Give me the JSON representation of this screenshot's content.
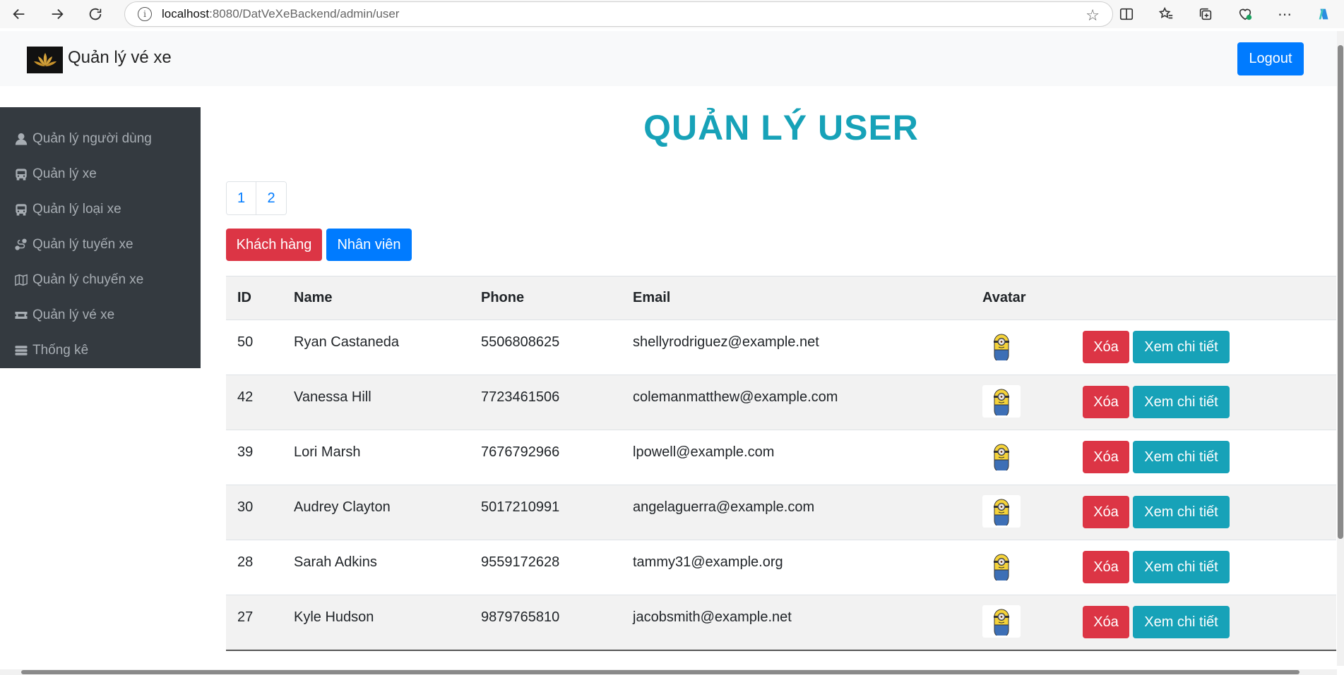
{
  "browser": {
    "url_host": "localhost",
    "url_path": ":8080/DatVeXeBackend/admin/user"
  },
  "navbar": {
    "brand": "Quản lý vé xe",
    "logout_label": "Logout"
  },
  "sidebar": {
    "items": [
      {
        "label": "Quản lý người dùng",
        "icon": "user-icon"
      },
      {
        "label": "Quản lý xe",
        "icon": "bus-icon"
      },
      {
        "label": "Quản lý loại xe",
        "icon": "bus-icon"
      },
      {
        "label": "Quản lý tuyến xe",
        "icon": "route-icon"
      },
      {
        "label": "Quản lý chuyến xe",
        "icon": "map-icon"
      },
      {
        "label": "Quản lý vé xe",
        "icon": "ticket-icon"
      },
      {
        "label": "Thống kê",
        "icon": "bars-icon"
      }
    ]
  },
  "main": {
    "title": "QUẢN LÝ USER",
    "pages": [
      "1",
      "2"
    ],
    "filters": {
      "customer_label": "Khách hàng",
      "staff_label": "Nhân viên"
    },
    "table": {
      "headers": {
        "id": "ID",
        "name": "Name",
        "phone": "Phone",
        "email": "Email",
        "avatar": "Avatar"
      },
      "delete_label": "Xóa",
      "view_label": "Xem chi tiết",
      "rows": [
        {
          "id": "50",
          "name": "Ryan Castaneda",
          "phone": "5506808625",
          "email": "shellyrodriguez@example.net"
        },
        {
          "id": "42",
          "name": "Vanessa Hill",
          "phone": "7723461506",
          "email": "colemanmatthew@example.com"
        },
        {
          "id": "39",
          "name": "Lori Marsh",
          "phone": "7676792966",
          "email": "lpowell@example.com"
        },
        {
          "id": "30",
          "name": "Audrey Clayton",
          "phone": "5017210991",
          "email": "angelaguerra@example.com"
        },
        {
          "id": "28",
          "name": "Sarah Adkins",
          "phone": "9559172628",
          "email": "tammy31@example.org"
        },
        {
          "id": "27",
          "name": "Kyle Hudson",
          "phone": "9879765810",
          "email": "jacobsmith@example.net"
        }
      ]
    }
  },
  "colors": {
    "primary": "#007bff",
    "danger": "#dc3545",
    "info": "#17a2b8",
    "sidebar_bg": "#343a40"
  }
}
